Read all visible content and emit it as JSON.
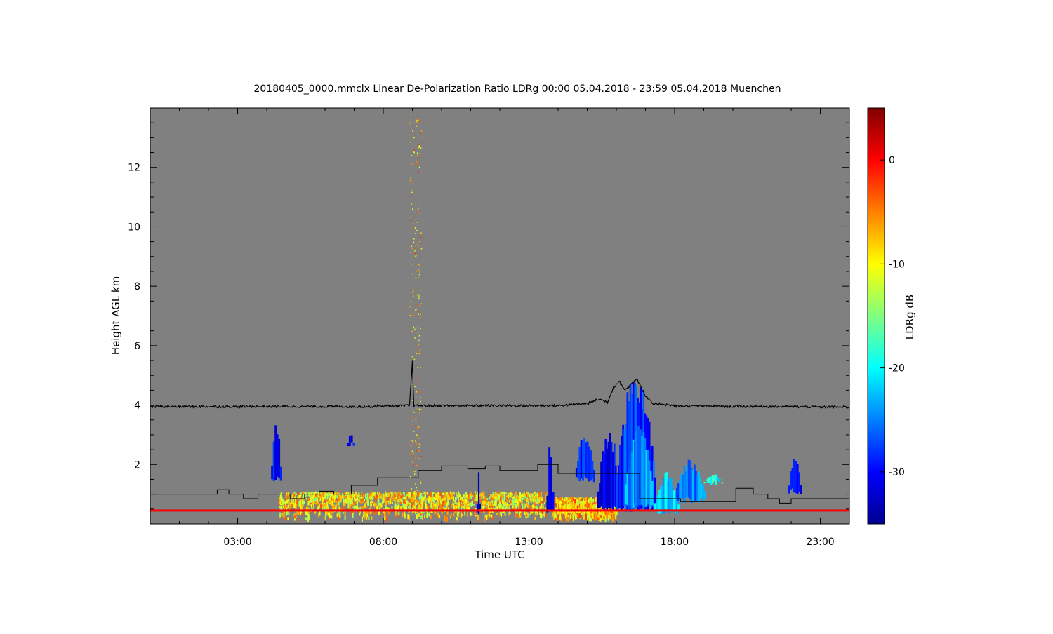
{
  "chart_data": {
    "type": "heatmap",
    "title": "20180405_0000.mmclx Linear De-Polarization Ratio LDRg   00:00 05.04.2018 - 23:59 05.04.2018 Muenchen",
    "xlabel": "Time UTC",
    "ylabel": "Height AGL km",
    "xlim": [
      0.0,
      24.0
    ],
    "ylim": [
      0.0,
      14.0
    ],
    "xticks": [
      {
        "value": 3.0,
        "label": "03:00"
      },
      {
        "value": 8.0,
        "label": "08:00"
      },
      {
        "value": 13.0,
        "label": "13:00"
      },
      {
        "value": 18.0,
        "label": "18:00"
      },
      {
        "value": 23.0,
        "label": "23:00"
      }
    ],
    "yticks": [
      {
        "value": 2,
        "label": "2"
      },
      {
        "value": 4,
        "label": "4"
      },
      {
        "value": 6,
        "label": "6"
      },
      {
        "value": 8,
        "label": "8"
      },
      {
        "value": 10,
        "label": "10"
      },
      {
        "value": 12,
        "label": "12"
      }
    ],
    "background_color": "#808080",
    "colorbar": {
      "label": "LDRg dB",
      "range": [
        -35,
        5
      ],
      "ticks": [
        {
          "value": 0,
          "label": "0"
        },
        {
          "value": -10,
          "label": "-10"
        },
        {
          "value": -20,
          "label": "-20"
        },
        {
          "value": -30,
          "label": "-30"
        }
      ],
      "colormap": [
        "#00008f",
        "#0000ff",
        "#0080ff",
        "#00ffff",
        "#80ff80",
        "#ffff00",
        "#ff8000",
        "#ff0000",
        "#800000"
      ]
    },
    "upper_line": {
      "name": "",
      "points": [
        [
          0.0,
          3.95
        ],
        [
          7.5,
          3.95
        ],
        [
          7.9,
          3.97
        ],
        [
          8.9,
          3.98
        ],
        [
          9.0,
          5.45
        ],
        [
          9.05,
          3.98
        ],
        [
          14.0,
          3.98
        ],
        [
          15.0,
          4.05
        ],
        [
          15.4,
          4.2
        ],
        [
          15.7,
          4.1
        ],
        [
          15.9,
          4.6
        ],
        [
          16.1,
          4.8
        ],
        [
          16.3,
          4.5
        ],
        [
          16.5,
          4.7
        ],
        [
          16.7,
          4.9
        ],
        [
          17.0,
          4.3
        ],
        [
          17.3,
          4.0
        ],
        [
          17.5,
          4.05
        ],
        [
          18.0,
          3.97
        ],
        [
          24.0,
          3.93
        ]
      ]
    },
    "step_line": {
      "name": "",
      "points": [
        [
          0.0,
          1.0
        ],
        [
          2.3,
          1.0
        ],
        [
          2.3,
          1.15
        ],
        [
          2.7,
          1.15
        ],
        [
          2.7,
          1.0
        ],
        [
          3.2,
          1.0
        ],
        [
          3.2,
          0.85
        ],
        [
          3.7,
          0.85
        ],
        [
          3.7,
          1.0
        ],
        [
          4.8,
          1.0
        ],
        [
          4.8,
          0.85
        ],
        [
          5.3,
          0.85
        ],
        [
          5.3,
          1.0
        ],
        [
          5.8,
          1.0
        ],
        [
          5.8,
          1.1
        ],
        [
          6.3,
          1.1
        ],
        [
          6.3,
          1.0
        ],
        [
          6.9,
          1.0
        ],
        [
          6.9,
          1.3
        ],
        [
          7.8,
          1.3
        ],
        [
          7.8,
          1.55
        ],
        [
          9.2,
          1.55
        ],
        [
          9.2,
          1.8
        ],
        [
          10.0,
          1.8
        ],
        [
          10.0,
          1.95
        ],
        [
          10.9,
          1.95
        ],
        [
          10.9,
          1.85
        ],
        [
          11.5,
          1.85
        ],
        [
          11.5,
          1.95
        ],
        [
          12.0,
          1.95
        ],
        [
          12.0,
          1.8
        ],
        [
          13.3,
          1.8
        ],
        [
          13.3,
          2.0
        ],
        [
          14.0,
          2.0
        ],
        [
          14.0,
          1.7
        ],
        [
          16.8,
          1.7
        ],
        [
          16.8,
          0.85
        ],
        [
          18.2,
          0.85
        ],
        [
          18.2,
          0.75
        ],
        [
          20.1,
          0.75
        ],
        [
          20.1,
          1.2
        ],
        [
          20.7,
          1.2
        ],
        [
          20.7,
          1.0
        ],
        [
          21.2,
          1.0
        ],
        [
          21.2,
          0.85
        ],
        [
          21.6,
          0.85
        ],
        [
          21.6,
          0.7
        ],
        [
          22.0,
          0.7
        ],
        [
          22.0,
          0.85
        ],
        [
          24.0,
          0.85
        ]
      ]
    },
    "echo_regions": [
      {
        "t0": 4.15,
        "t1": 4.45,
        "h0": 1.4,
        "h1": 3.5,
        "ldr": -30
      },
      {
        "t0": 6.75,
        "t1": 6.95,
        "h0": 2.6,
        "h1": 3.1,
        "ldr": -31
      },
      {
        "t0": 14.6,
        "t1": 15.2,
        "h0": 1.4,
        "h1": 3.2,
        "ldr": -29
      },
      {
        "t0": 15.35,
        "t1": 16.1,
        "h0": 0.4,
        "h1": 3.3,
        "ldr": -30
      },
      {
        "t0": 16.0,
        "t1": 17.3,
        "h0": 0.4,
        "h1": 5.3,
        "ldr": -28
      },
      {
        "t0": 16.3,
        "t1": 17.2,
        "h0": 0.5,
        "h1": 3.8,
        "ldr": -24
      },
      {
        "t0": 17.3,
        "t1": 18.1,
        "h0": 0.3,
        "h1": 1.8,
        "ldr": -22
      },
      {
        "t0": 18.0,
        "t1": 19.0,
        "h0": 0.7,
        "h1": 2.2,
        "ldr": -25
      },
      {
        "t0": 19.0,
        "t1": 19.6,
        "h0": 1.3,
        "h1": 1.7,
        "ldr": -20
      },
      {
        "t0": 21.9,
        "t1": 22.3,
        "h0": 1.0,
        "h1": 2.3,
        "ldr": -31
      },
      {
        "t0": 13.6,
        "t1": 13.8,
        "h0": 0.3,
        "h1": 3.0,
        "ldr": -31
      },
      {
        "t0": 11.2,
        "t1": 11.3,
        "h0": 0.3,
        "h1": 1.8,
        "ldr": -33
      }
    ],
    "low_clutter": [
      {
        "t0": 4.4,
        "t1": 13.6,
        "h0": 0.2,
        "h1": 1.1,
        "ldr": -9
      },
      {
        "t0": 13.8,
        "t1": 16.0,
        "h0": 0.2,
        "h1": 0.9,
        "ldr": -8
      },
      {
        "t0": 8.9,
        "t1": 9.3,
        "h0": 0.2,
        "h1": 13.8,
        "ldr": -7
      }
    ],
    "ground_line": {
      "h": 0.45,
      "ldr": 0
    }
  }
}
